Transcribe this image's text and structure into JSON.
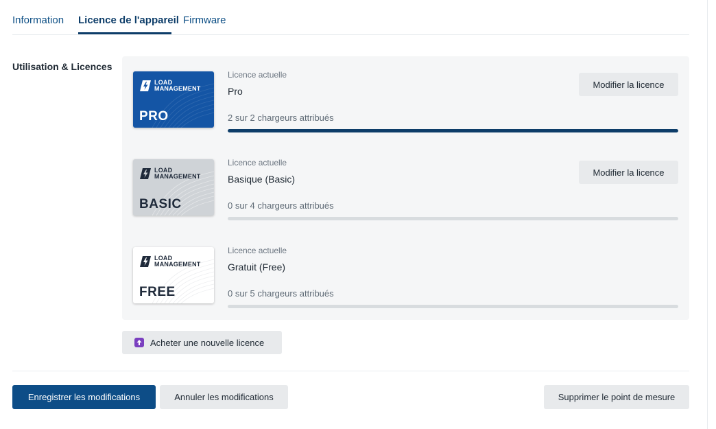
{
  "tabs": [
    {
      "label": "Information",
      "active": false
    },
    {
      "label": "Licence de l'appareil",
      "active": true
    },
    {
      "label": "Firmware",
      "active": false
    }
  ],
  "section": {
    "label": "Utilisation & Licences"
  },
  "card_brand": {
    "line1": "LOAD",
    "line2": "MANAGEMENT"
  },
  "licenses": [
    {
      "tier": "PRO",
      "label": "Licence actuelle",
      "name": "Pro",
      "usage": "2 sur 2 chargeurs attribués",
      "used": 2,
      "total": 2,
      "modify_label": "Modifier la licence",
      "card_color": "#1455a5"
    },
    {
      "tier": "BASIC",
      "label": "Licence actuelle",
      "name": "Basique (Basic)",
      "usage": "0 sur 4 chargeurs attribués",
      "used": 0,
      "total": 4,
      "modify_label": "Modifier la licence",
      "card_color": "#cfd3d7"
    },
    {
      "tier": "FREE",
      "label": "Licence actuelle",
      "name": "Gratuit (Free)",
      "usage": "0 sur 5 chargeurs attribués",
      "used": 0,
      "total": 5,
      "card_color": "#ffffff"
    }
  ],
  "buy": {
    "label": "Acheter une nouvelle licence",
    "icon": "upload-arrow-icon"
  },
  "footer": {
    "save_label": "Enregistrer les modifications",
    "cancel_label": "Annuler les modifications",
    "delete_label": "Supprimer le point de mesure"
  },
  "colors": {
    "primary": "#0d4d87",
    "accent": "#7a3fbf",
    "bar_fill": "#0d3d69",
    "bar_track": "#d8dcdf"
  }
}
